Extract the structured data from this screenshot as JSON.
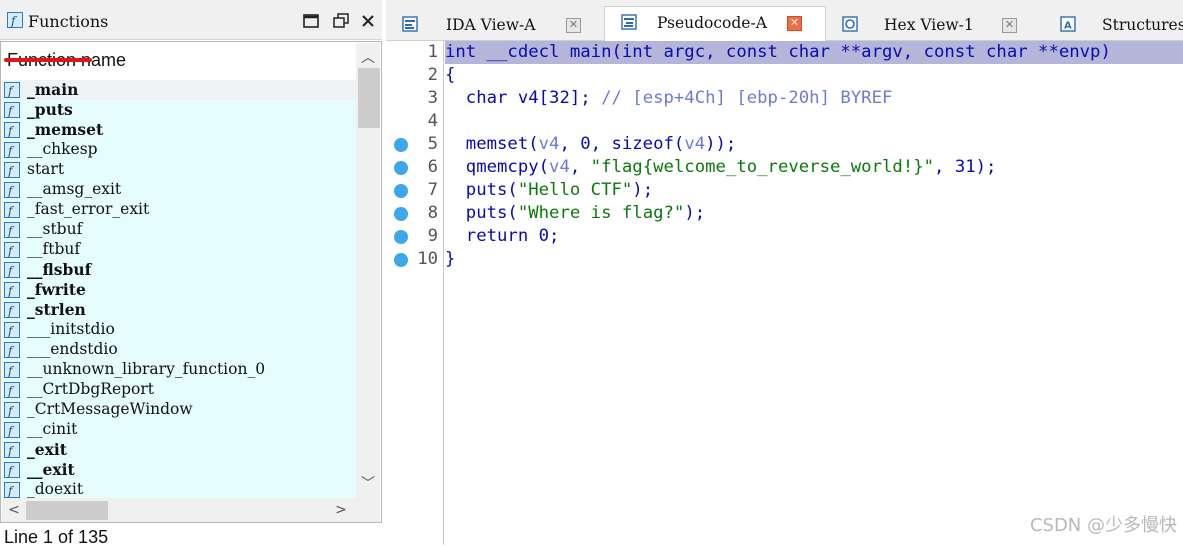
{
  "functions_panel": {
    "title": "Functions",
    "column_header": "Function name",
    "status": "Line 1 of 135",
    "icon_letter": "f",
    "items": [
      {
        "name": "_main",
        "bold": true,
        "selected": true
      },
      {
        "name": "_puts",
        "bold": true
      },
      {
        "name": "_memset",
        "bold": true
      },
      {
        "name": "__chkesp",
        "bold": false
      },
      {
        "name": "start",
        "bold": false
      },
      {
        "name": "__amsg_exit",
        "bold": false
      },
      {
        "name": "_fast_error_exit",
        "bold": false
      },
      {
        "name": "__stbuf",
        "bold": false
      },
      {
        "name": "__ftbuf",
        "bold": false
      },
      {
        "name": "__flsbuf",
        "bold": true
      },
      {
        "name": "_fwrite",
        "bold": true
      },
      {
        "name": "_strlen",
        "bold": true
      },
      {
        "name": "___initstdio",
        "bold": false
      },
      {
        "name": "___endstdio",
        "bold": false
      },
      {
        "name": "__unknown_library_function_0",
        "bold": false
      },
      {
        "name": "__CrtDbgReport",
        "bold": false
      },
      {
        "name": "_CrtMessageWindow",
        "bold": false
      },
      {
        "name": "__cinit",
        "bold": false
      },
      {
        "name": "_exit",
        "bold": true
      },
      {
        "name": "__exit",
        "bold": true
      },
      {
        "name": "_doexit",
        "bold": false
      }
    ]
  },
  "tabs": [
    {
      "label": "IDA View-A",
      "icon": "ida-view-icon",
      "active": false
    },
    {
      "label": "Pseudocode-A",
      "icon": "pseudocode-icon",
      "active": true
    },
    {
      "label": "Hex View-1",
      "icon": "hex-view-icon",
      "active": false
    },
    {
      "label": "Structures",
      "icon": "structures-icon",
      "active": false
    }
  ],
  "code": {
    "lines": [
      {
        "n": "1",
        "bp": false,
        "hl": true,
        "parts": [
          [
            "k",
            "int __cdecl main(int argc, const char **argv, const char **envp)"
          ]
        ]
      },
      {
        "n": "2",
        "bp": false,
        "hl": false,
        "parts": [
          [
            "k",
            "{"
          ]
        ]
      },
      {
        "n": "3",
        "bp": false,
        "hl": false,
        "parts": [
          [
            "k",
            "  char v4[32]; "
          ],
          [
            "c",
            "// [esp+4Ch] [ebp-20h] BYREF"
          ]
        ]
      },
      {
        "n": "4",
        "bp": false,
        "hl": false,
        "parts": [
          [
            "k",
            ""
          ]
        ]
      },
      {
        "n": "5",
        "bp": true,
        "hl": false,
        "parts": [
          [
            "k",
            "  memset("
          ],
          [
            "v",
            "v4"
          ],
          [
            "k",
            ", 0, sizeof("
          ],
          [
            "v",
            "v4"
          ],
          [
            "k",
            "));"
          ]
        ]
      },
      {
        "n": "6",
        "bp": true,
        "hl": false,
        "parts": [
          [
            "k",
            "  qmemcpy("
          ],
          [
            "v",
            "v4"
          ],
          [
            "k",
            ", "
          ],
          [
            "s",
            "\"flag{welcome_to_reverse_world!}\""
          ],
          [
            "k",
            ", 31);"
          ]
        ]
      },
      {
        "n": "7",
        "bp": true,
        "hl": false,
        "parts": [
          [
            "k",
            "  puts("
          ],
          [
            "s",
            "\"Hello CTF\""
          ],
          [
            "k",
            ");"
          ]
        ]
      },
      {
        "n": "8",
        "bp": true,
        "hl": false,
        "parts": [
          [
            "k",
            "  puts("
          ],
          [
            "s",
            "\"Where is flag?\""
          ],
          [
            "k",
            ");"
          ]
        ]
      },
      {
        "n": "9",
        "bp": true,
        "hl": false,
        "parts": [
          [
            "k",
            "  return 0;"
          ]
        ]
      },
      {
        "n": "10",
        "bp": true,
        "hl": false,
        "parts": [
          [
            "k",
            "}"
          ]
        ]
      }
    ]
  },
  "watermark": "CSDN @少多慢快",
  "colors": {
    "list_bg": "#e6fdfd",
    "highlight_line": "#b4b5d8",
    "keyword": "#0a0ab0",
    "string": "#0b7a0b",
    "breakpoint": "#3ea7e9",
    "active_tab_close": "#f26b43",
    "annotation_underline": "#e0161a"
  }
}
